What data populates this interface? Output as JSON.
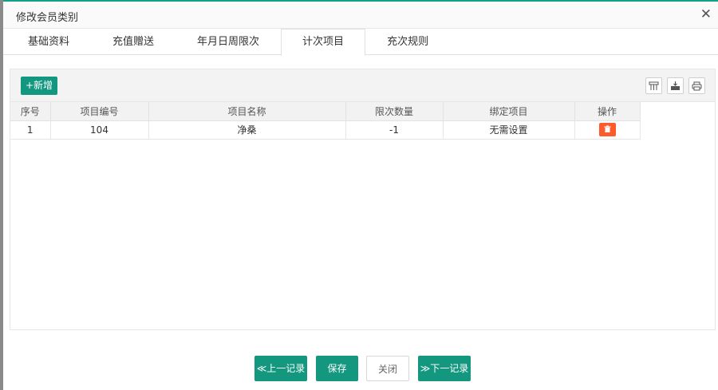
{
  "dialog": {
    "title": "修改会员类别",
    "close_label": "✕"
  },
  "tabs": [
    {
      "label": "基础资料"
    },
    {
      "label": "充值赠送"
    },
    {
      "label": "年月日周限次"
    },
    {
      "label": "计次项目"
    },
    {
      "label": "充次规则"
    }
  ],
  "active_tab": "计次项目",
  "toolbar": {
    "add_label": "+新增",
    "icons": [
      "columns-icon",
      "export-icon",
      "print-icon"
    ]
  },
  "table": {
    "headers": [
      "序号",
      "项目编号",
      "项目名称",
      "限次数量",
      "绑定项目",
      "操作"
    ],
    "rows": [
      {
        "index": "1",
        "code": "104",
        "name": "净桑",
        "limit": "-1",
        "bind": "无需设置",
        "action_icon": "trash-icon"
      }
    ]
  },
  "footer": {
    "prev_label": "≪上一记录",
    "save_label": "保存",
    "close_label": "关闭",
    "next_label": "≫下一记录"
  },
  "colors": {
    "accent": "#13977f",
    "danger": "#fc5b2c"
  }
}
